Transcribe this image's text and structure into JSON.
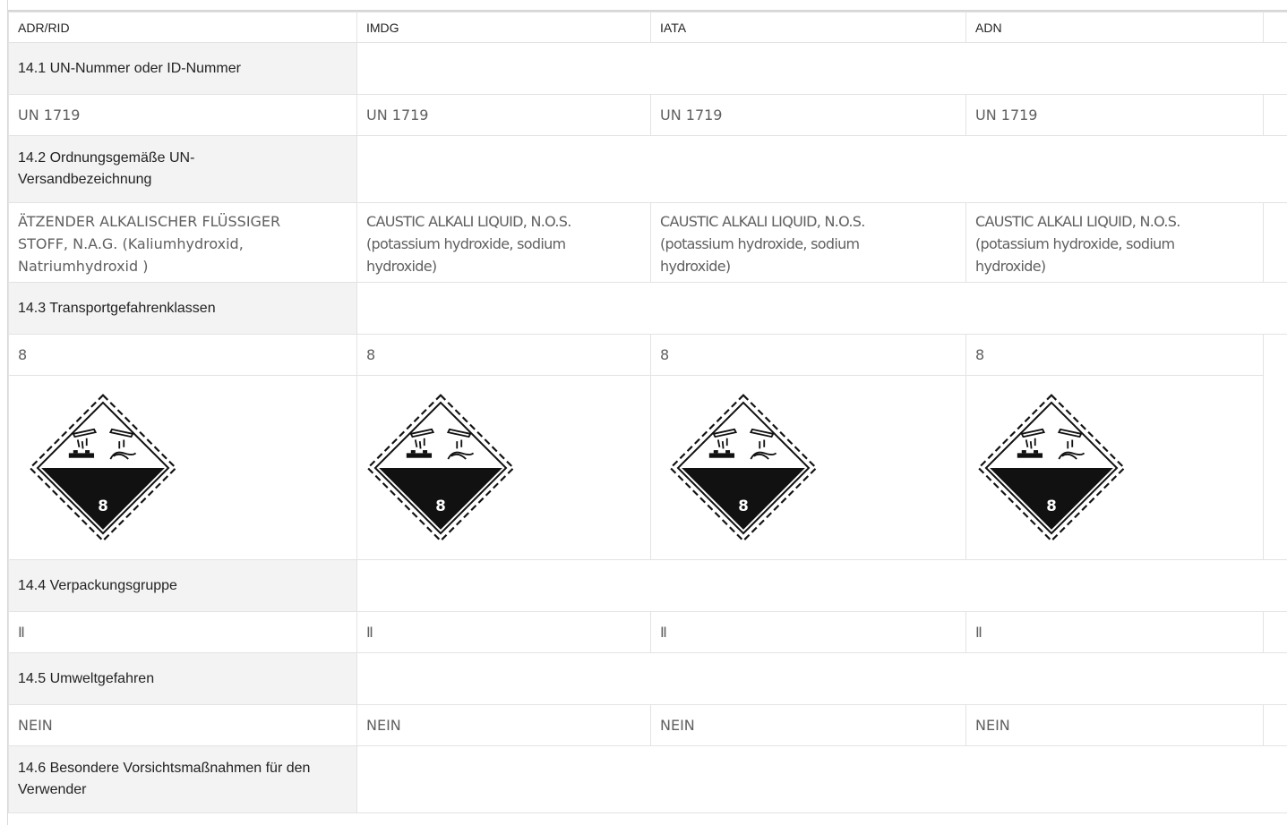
{
  "columns": [
    "ADR/RID",
    "IMDG",
    "IATA",
    "ADN"
  ],
  "sections": {
    "un_number": {
      "label": "14.1 UN-Nummer oder ID-Nummer",
      "values": [
        "UN 1719",
        "UN 1719",
        "UN 1719",
        "UN 1719"
      ]
    },
    "shipping_name": {
      "label": "14.2 Ordnungsgemäße UN-Versandbezeichnung",
      "values": [
        "ÄTZENDER ALKALISCHER FLÜSSIGER STOFF, N.A.G. (Kaliumhydroxid, Natriumhydroxid )",
        "CAUSTIC ALKALI LIQUID, N.O.S. (potassium hydroxide, sodium hydroxide)",
        "CAUSTIC ALKALI LIQUID, N.O.S. (potassium hydroxide, sodium hydroxide)",
        "CAUSTIC ALKALI LIQUID, N.O.S. (potassium hydroxide, sodium hydroxide)"
      ]
    },
    "hazard_class": {
      "label": "14.3 Transportgefahrenklassen",
      "values": [
        "8",
        "8",
        "8",
        "8"
      ],
      "pictogram": {
        "icon": "corrosive-class-8-diamond-icon",
        "number": "8"
      }
    },
    "packing_group": {
      "label": "14.4 Verpackungsgruppe",
      "values": [
        "Ⅱ",
        "Ⅱ",
        "Ⅱ",
        "Ⅱ"
      ]
    },
    "environment": {
      "label": "14.5 Umweltgefahren",
      "values": [
        "NEIN",
        "NEIN",
        "NEIN",
        "NEIN"
      ]
    },
    "precautions": {
      "label": "14.6 Besondere Vorsichtsmaßnahmen für den Verwender"
    }
  },
  "colors": {
    "label_bg": "#f3f3f4",
    "border": "#e3e3e3",
    "value_text": "#606060"
  }
}
